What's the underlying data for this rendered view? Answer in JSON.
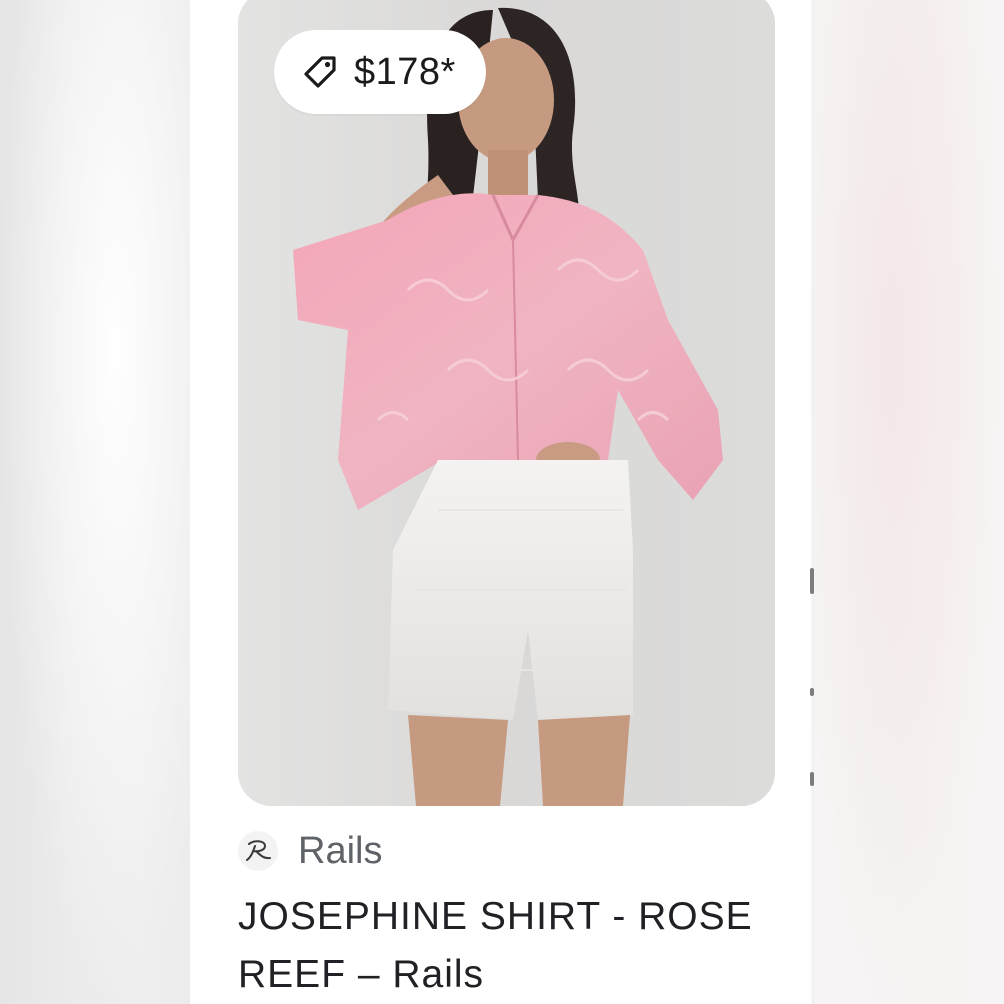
{
  "product": {
    "price": "$178*",
    "source_name": "Rails",
    "title": "JOSEPHINE SHIRT - ROSE REEF – Rails",
    "image_alt": "Model wearing pink printed button-down shirt with white shorts"
  },
  "icons": {
    "price": "tag-icon",
    "source": "rails-logo-icon"
  },
  "colors": {
    "card_background": "#ffffff",
    "text_primary": "#202124",
    "text_secondary": "#5f6368",
    "pill_background": "#ffffff"
  }
}
